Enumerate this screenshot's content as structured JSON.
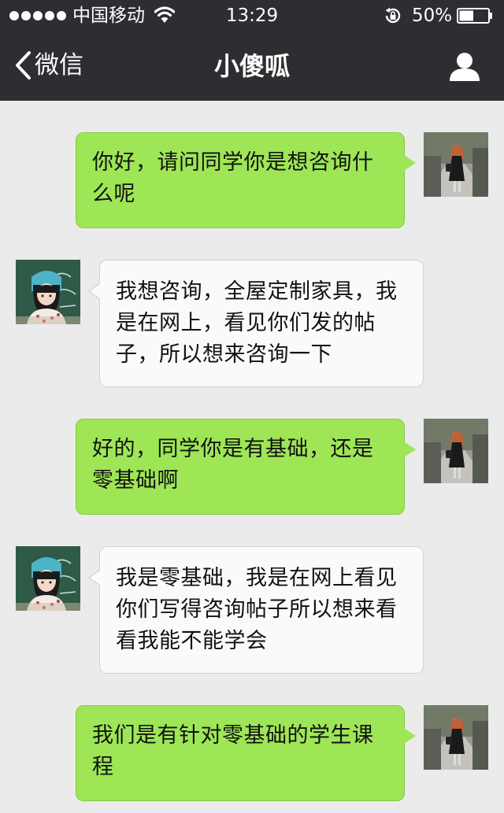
{
  "status_bar": {
    "carrier": "中国移动",
    "time": "13:29",
    "battery_percent": "50%",
    "battery_level": 0.5,
    "signal_bars": 5
  },
  "nav": {
    "back_label": "微信",
    "title": "小傻呱"
  },
  "messages": [
    {
      "sender": "me",
      "text": "你好，请问同学你是想咨询什么呢"
    },
    {
      "sender": "them",
      "text": "我想咨询，全屋定制家具，我是在网上，看见你们发的帖子，所以想来咨询一下"
    },
    {
      "sender": "me",
      "text": "好的，同学你是有基础，还是零基础啊"
    },
    {
      "sender": "them",
      "text": "我是零基础，我是在网上看见你们写得咨询帖子所以想来看看我能不能学会"
    },
    {
      "sender": "me",
      "text": "我们是有针对零基础的学生课程"
    }
  ],
  "colors": {
    "header_bg": "#2e2e32",
    "chat_bg": "#ebebeb",
    "my_bubble": "#9ee656",
    "their_bubble": "#fafafa"
  }
}
